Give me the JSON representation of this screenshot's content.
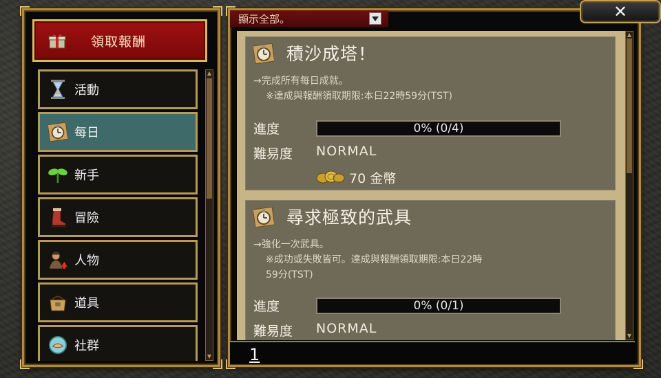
{
  "left_panel": {
    "claim_button": {
      "label": "領取報酬",
      "icon": "gift-icon"
    },
    "categories": [
      {
        "label": "活動",
        "icon": "hourglass-icon",
        "active": false
      },
      {
        "label": "每日",
        "icon": "pocket-watch-icon",
        "active": true
      },
      {
        "label": "新手",
        "icon": "sprout-icon",
        "active": false
      },
      {
        "label": "冒險",
        "icon": "boot-icon",
        "active": false
      },
      {
        "label": "人物",
        "icon": "character-icon",
        "active": false
      },
      {
        "label": "道具",
        "icon": "satchel-icon",
        "active": false
      },
      {
        "label": "社群",
        "icon": "handshake-icon",
        "active": false
      }
    ]
  },
  "right_panel": {
    "filter": {
      "value": "顯示全部。",
      "icon": "dropdown-arrow-icon"
    },
    "close_button": {
      "label": "✕",
      "icon": "close-icon"
    },
    "quests": [
      {
        "icon": "pocket-watch-icon",
        "title": "積沙成塔！",
        "description": "→完成所有每日成就。",
        "note_lines": [
          "※達成與報酬領取期限:本日22時59分(TST)"
        ],
        "progress_label": "進度",
        "progress_text": "0% (0/4)",
        "progress_fraction": 0,
        "difficulty_label": "難易度",
        "difficulty": "NORMAL",
        "reward": {
          "amount": "70 金幣",
          "icon": "gold-coins-icon"
        }
      },
      {
        "icon": "pocket-watch-icon",
        "title": "尋求極致的武具",
        "description": "→強化一次武具。",
        "note_lines": [
          "※成功或失敗皆可。達成與報酬領取期限:本日22時",
          "59分(TST)"
        ],
        "progress_label": "進度",
        "progress_text": "0% (0/1)",
        "progress_fraction": 0,
        "difficulty_label": "難易度",
        "difficulty": "NORMAL"
      }
    ],
    "page": "1"
  },
  "colors": {
    "frame_gold": "#b08a3e",
    "claim_red": "#a01010",
    "active_teal": "#3e6a6a",
    "card_bg": "#6f6a58",
    "parchment": "#c7b588"
  }
}
